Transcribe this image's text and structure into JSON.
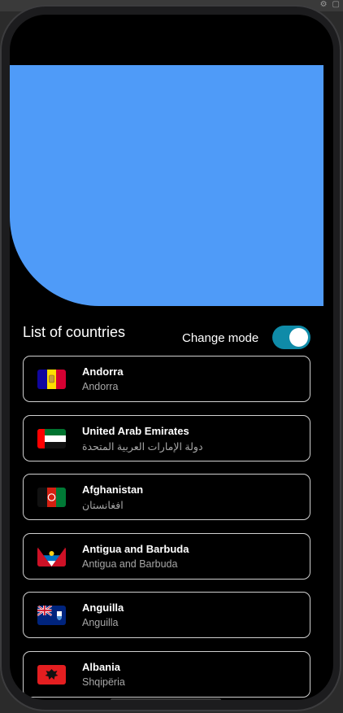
{
  "screen": {
    "section_title": "List of countries",
    "mode_toggle": {
      "label": "Change mode",
      "on": true
    }
  },
  "colors": {
    "header": "#4f9bf8",
    "toggle_track": "#0f8ba8",
    "background": "#000000",
    "card_border": "#cfcfcf"
  },
  "countries": [
    {
      "name": "Andorra",
      "native": "Andorra",
      "flag_icon": "andorra-flag-icon"
    },
    {
      "name": "United Arab Emirates",
      "native": "دولة الإمارات العربية المتحدة",
      "flag_icon": "uae-flag-icon"
    },
    {
      "name": "Afghanistan",
      "native": "افغانستان",
      "flag_icon": "afghanistan-flag-icon"
    },
    {
      "name": "Antigua and Barbuda",
      "native": "Antigua and Barbuda",
      "flag_icon": "antigua-flag-icon"
    },
    {
      "name": "Anguilla",
      "native": "Anguilla",
      "flag_icon": "anguilla-flag-icon"
    },
    {
      "name": "Albania",
      "native": "Shqipëria",
      "flag_icon": "albania-flag-icon"
    }
  ]
}
